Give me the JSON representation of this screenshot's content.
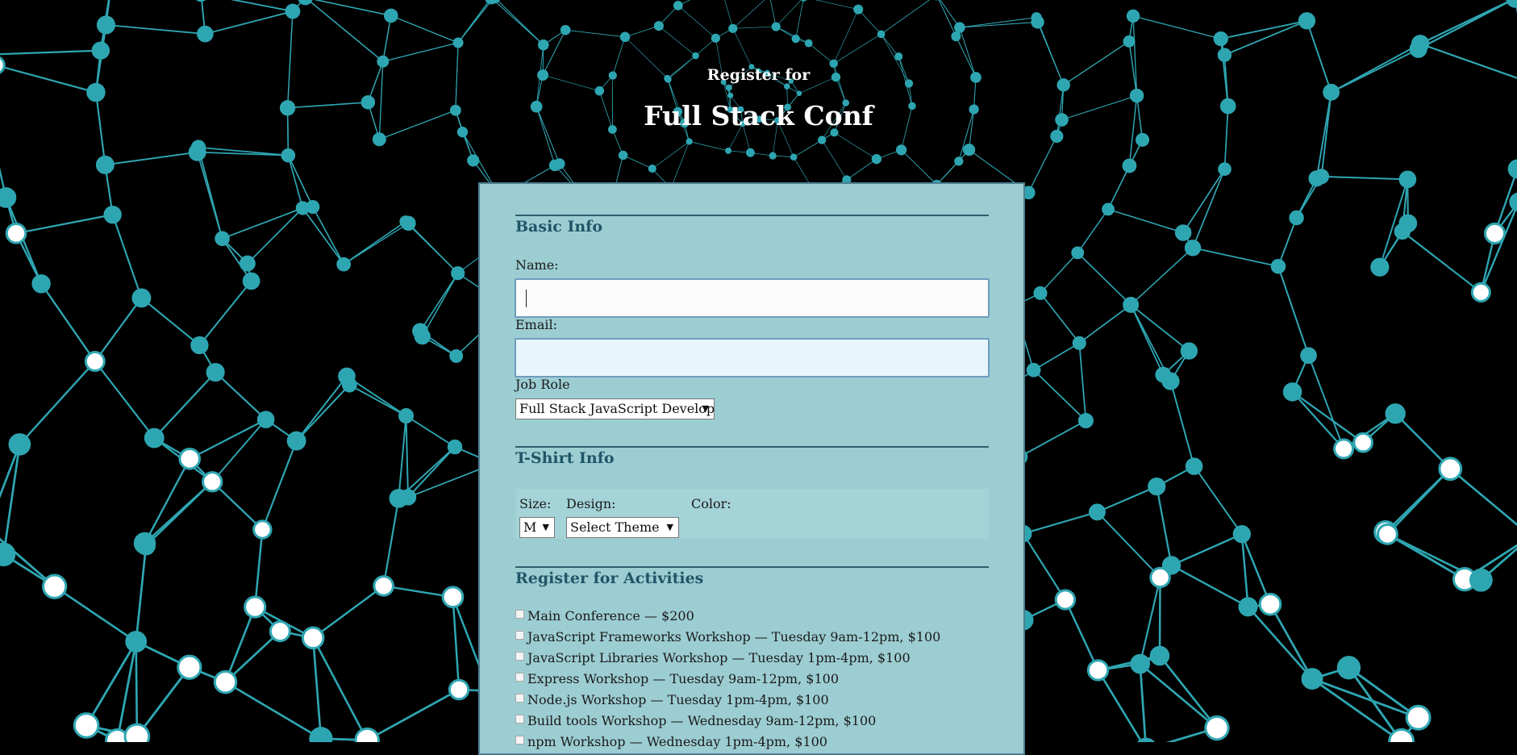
{
  "header": {
    "subtitle": "Register for",
    "title": "Full Stack Conf"
  },
  "colors": {
    "panel": "#9ccdd2",
    "accent": "#1f5567",
    "network": "#2ea6b2"
  },
  "basic_info": {
    "section_title": "Basic Info",
    "name_label": "Name:",
    "name_value": "",
    "email_label": "Email:",
    "email_value": "",
    "job_role_label": "Job Role",
    "job_role_selected": "Full Stack JavaScript Developer"
  },
  "tshirt": {
    "section_title": "T-Shirt Info",
    "size_label": "Size:",
    "size_selected": "M",
    "design_label": "Design:",
    "design_selected": "Select Theme",
    "color_label": "Color:"
  },
  "activities": {
    "section_title": "Register for Activities",
    "items": [
      {
        "label": "Main Conference — $200",
        "checked": false
      },
      {
        "label": "JavaScript Frameworks Workshop — Tuesday 9am-12pm, $100",
        "checked": false
      },
      {
        "label": "JavaScript Libraries Workshop — Tuesday 1pm-4pm, $100",
        "checked": false
      },
      {
        "label": "Express Workshop — Tuesday 9am-12pm, $100",
        "checked": false
      },
      {
        "label": "Node.js Workshop — Tuesday 1pm-4pm, $100",
        "checked": false
      },
      {
        "label": "Build tools Workshop — Wednesday 9am-12pm, $100",
        "checked": false
      },
      {
        "label": "npm Workshop — Wednesday 1pm-4pm, $100",
        "checked": false
      }
    ]
  }
}
